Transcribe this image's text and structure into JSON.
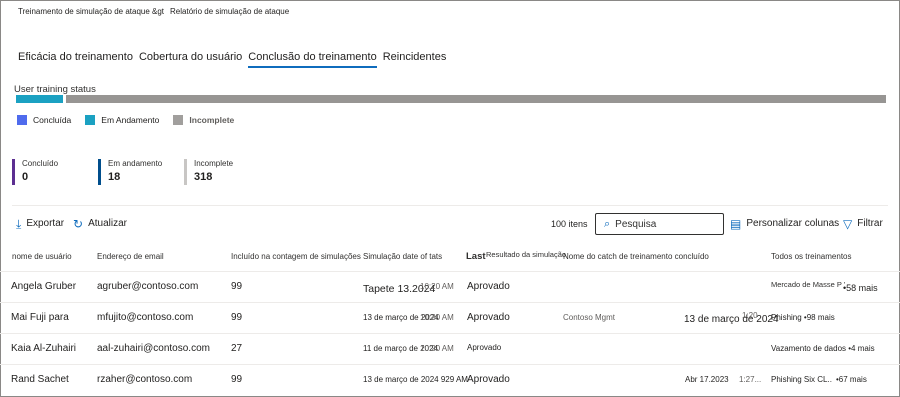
{
  "breadcrumb": {
    "parent": "Treinamento de simulação de ataque &gt",
    "current": "Relatório de simulação de ataque"
  },
  "tabs": [
    {
      "label": "Eficácia do treinamento",
      "active": false
    },
    {
      "label": "Cobertura do usuário",
      "active": false
    },
    {
      "label": "Conclusão do treinamento",
      "active": true
    },
    {
      "label": "Reincidentes",
      "active": false
    }
  ],
  "status": {
    "section_label": "User training status",
    "bar": [
      {
        "name": "Concluída",
        "fraction": 0.0,
        "color": "#4f6bed"
      },
      {
        "name": "Em Andamento",
        "fraction": 0.054,
        "color": "#1ba1c2"
      },
      {
        "name": "Incomplete",
        "fraction": 0.946,
        "color": "#979593"
      }
    ],
    "legend": [
      {
        "label": "Concluída",
        "color": "#4f6bed",
        "bold": false
      },
      {
        "label": "Em Andamento",
        "color": "#1ba1c2",
        "bold": false
      },
      {
        "label": "Incomplete",
        "color": "#a19f9d",
        "bold": true
      }
    ]
  },
  "stats": [
    {
      "label": "Concluído",
      "value": "0",
      "color": "#5c2e91"
    },
    {
      "label": "Em andamento",
      "value": "18",
      "color": "#004e8c"
    },
    {
      "label": "Incomplete",
      "value": "318",
      "color": "#c8c6c4"
    }
  ],
  "toolbar": {
    "export_label": "Exportar",
    "refresh_label": "Atualizar",
    "count": "100 itens",
    "search_placeholder": "Pesquisa",
    "customize_label": "Personalizar colunas",
    "filter_label": "Filtrar"
  },
  "columns": {
    "name": "nome de usuário",
    "email": "Endereço de email",
    "included": "Incluído na contagem de simulações",
    "sim_date": "Simulação date of tats",
    "last": "Last",
    "result": "Resultado da simulação",
    "training": "Nome do catch de treinamento concluído",
    "all": "Todos os treinamentos"
  },
  "rows": [
    {
      "name": "Angela Gruber",
      "email": "agruber@contoso.com",
      "included": "99",
      "date": "Tapete 13.2024",
      "time": "10:20 AM",
      "result": "Aprovado",
      "training": "",
      "completed": "",
      "completed_time": "",
      "all": "Mercado de Masse P '",
      "more": "•58 mais"
    },
    {
      "name": "Mai Fuji para",
      "email": "mfujito@contoso.com",
      "included": "99",
      "date": "13 de março de 2024",
      "time": "10:20 AM",
      "result": "Aprovado",
      "training": "Contoso Mgmt",
      "completed": "13 de março de 2024",
      "completed_time": "1:20",
      "all": "Phishing •98 mais",
      "more": ""
    },
    {
      "name": "Kaia Al-Zuhairi",
      "email": "aal-zuhairi@contoso.com",
      "included": "27",
      "date": "11 de março de 2024",
      "time": "10:20 AM",
      "result": "Aprovado",
      "training": "",
      "completed": "",
      "completed_time": "",
      "all": "Vazamento de dados •4 mais",
      "more": ""
    },
    {
      "name": "Rand Sachet",
      "email": "rzaher@contoso.com",
      "included": "99",
      "date": "13 de março de 2024 929 AM",
      "time": "",
      "result": "Aprovado",
      "training": "",
      "completed": "Abr 17.2023",
      "completed_time": "1:27...",
      "all": "Phishing Six CL..",
      "more": "•67 mais"
    }
  ]
}
